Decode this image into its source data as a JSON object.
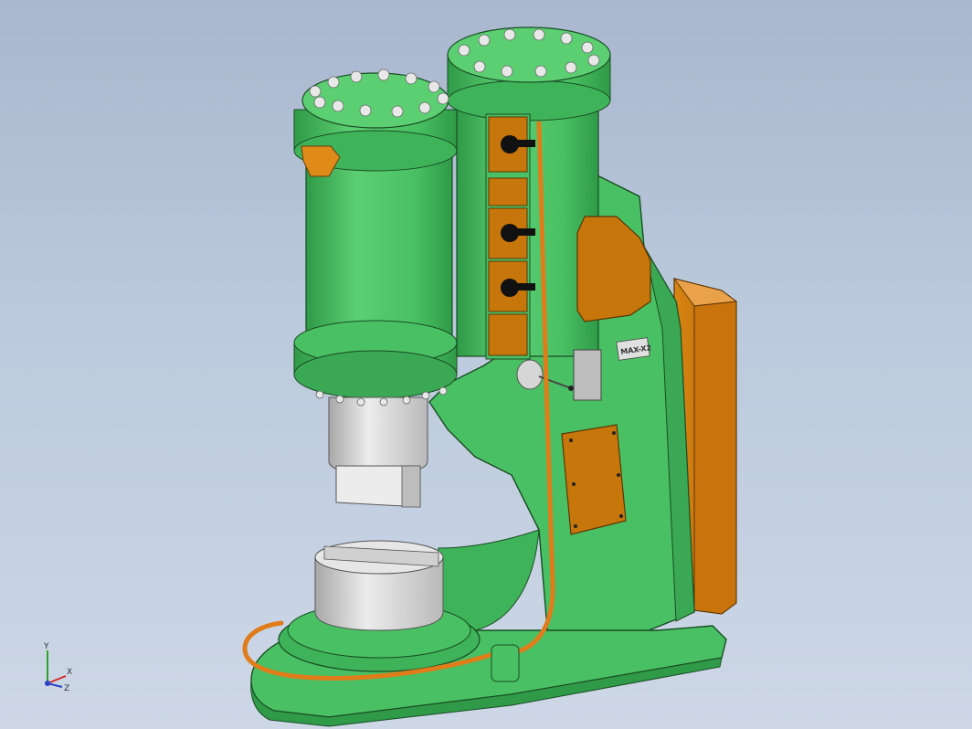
{
  "viewport": {
    "background": "#bccadd",
    "model": {
      "body_color": "#49c063",
      "body_shade": "#2f9a47",
      "cover_color": "#c7760c",
      "steel_color": "#d9d9d9",
      "pipe_color": "#e07c1a",
      "nameplate_text": "MAX-X2"
    },
    "triad": {
      "x_label": "X",
      "y_label": "Y",
      "z_label": "Z",
      "x_color": "#d62a2a",
      "y_color": "#2ca02c",
      "z_color": "#2845c8"
    }
  }
}
